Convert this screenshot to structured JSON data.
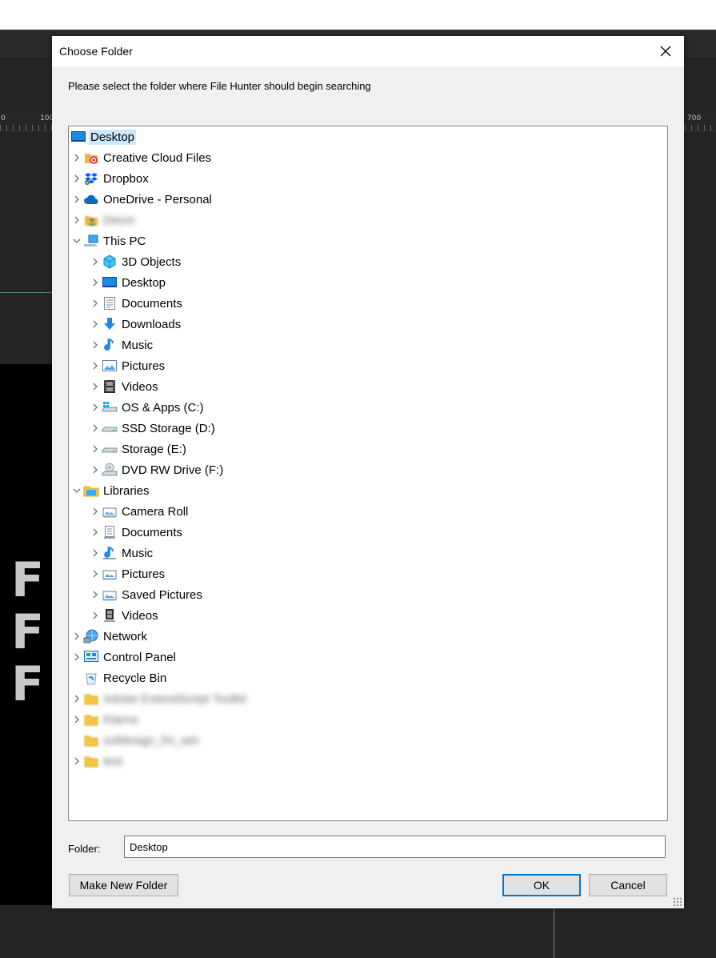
{
  "dialog": {
    "title": "Choose Folder",
    "instruction": "Please select the folder where File Hunter should begin searching",
    "folder_label": "Folder:",
    "folder_value": "Desktop",
    "buttons": {
      "new_folder": "Make New Folder",
      "ok": "OK",
      "cancel": "Cancel"
    }
  },
  "background": {
    "ruler_labels": [
      "0",
      "100",
      "700"
    ],
    "big_letters": [
      "F",
      "F",
      "F"
    ]
  },
  "tree": [
    {
      "label": "Desktop",
      "icon": "desktop-icon",
      "level": 0,
      "expander": "none",
      "selected": true
    },
    {
      "label": "Creative Cloud Files",
      "icon": "creative-cloud-folder-icon",
      "level": 1,
      "expander": "collapsed"
    },
    {
      "label": "Dropbox",
      "icon": "dropbox-icon",
      "level": 1,
      "expander": "collapsed"
    },
    {
      "label": "OneDrive - Personal",
      "icon": "onedrive-cloud-icon",
      "level": 1,
      "expander": "collapsed"
    },
    {
      "label": "Deom",
      "icon": "user-folder-icon",
      "level": 1,
      "expander": "collapsed",
      "blurred": true
    },
    {
      "label": "This PC",
      "icon": "computer-icon",
      "level": 1,
      "expander": "expanded"
    },
    {
      "label": "3D Objects",
      "icon": "3d-objects-icon",
      "level": 2,
      "expander": "collapsed"
    },
    {
      "label": "Desktop",
      "icon": "desktop-icon",
      "level": 2,
      "expander": "collapsed"
    },
    {
      "label": "Documents",
      "icon": "documents-icon",
      "level": 2,
      "expander": "collapsed"
    },
    {
      "label": "Downloads",
      "icon": "downloads-arrow-icon",
      "level": 2,
      "expander": "collapsed"
    },
    {
      "label": "Music",
      "icon": "music-note-icon",
      "level": 2,
      "expander": "collapsed"
    },
    {
      "label": "Pictures",
      "icon": "pictures-icon",
      "level": 2,
      "expander": "collapsed"
    },
    {
      "label": "Videos",
      "icon": "videos-film-icon",
      "level": 2,
      "expander": "collapsed"
    },
    {
      "label": "OS & Apps (C:)",
      "icon": "system-drive-icon",
      "level": 2,
      "expander": "collapsed"
    },
    {
      "label": "SSD Storage (D:)",
      "icon": "drive-icon",
      "level": 2,
      "expander": "collapsed"
    },
    {
      "label": "Storage (E:)",
      "icon": "drive-icon",
      "level": 2,
      "expander": "collapsed"
    },
    {
      "label": "DVD RW Drive (F:)",
      "icon": "dvd-drive-icon",
      "level": 2,
      "expander": "collapsed"
    },
    {
      "label": "Libraries",
      "icon": "libraries-icon",
      "level": 1,
      "expander": "expanded"
    },
    {
      "label": "Camera Roll",
      "icon": "library-pictures-icon",
      "level": 2,
      "expander": "collapsed"
    },
    {
      "label": "Documents",
      "icon": "library-documents-icon",
      "level": 2,
      "expander": "collapsed"
    },
    {
      "label": "Music",
      "icon": "library-music-icon",
      "level": 2,
      "expander": "collapsed"
    },
    {
      "label": "Pictures",
      "icon": "library-pictures-icon",
      "level": 2,
      "expander": "collapsed"
    },
    {
      "label": "Saved Pictures",
      "icon": "library-pictures-icon",
      "level": 2,
      "expander": "collapsed"
    },
    {
      "label": "Videos",
      "icon": "library-videos-icon",
      "level": 2,
      "expander": "collapsed"
    },
    {
      "label": "Network",
      "icon": "network-icon",
      "level": 1,
      "expander": "collapsed"
    },
    {
      "label": "Control Panel",
      "icon": "control-panel-icon",
      "level": 1,
      "expander": "collapsed"
    },
    {
      "label": "Recycle Bin",
      "icon": "recycle-bin-icon",
      "level": 1,
      "expander": "none"
    },
    {
      "label": "Adobe ExtendScript Toolkit",
      "icon": "folder-icon",
      "level": 1,
      "expander": "collapsed",
      "blurred": true
    },
    {
      "label": "Klarna",
      "icon": "folder-icon",
      "level": 1,
      "expander": "collapsed",
      "blurred": true
    },
    {
      "label": "sofdesign_fm_win",
      "icon": "folder-icon",
      "level": 1,
      "expander": "none",
      "blurred": true
    },
    {
      "label": "test",
      "icon": "folder-icon",
      "level": 1,
      "expander": "collapsed",
      "blurred": true
    }
  ]
}
